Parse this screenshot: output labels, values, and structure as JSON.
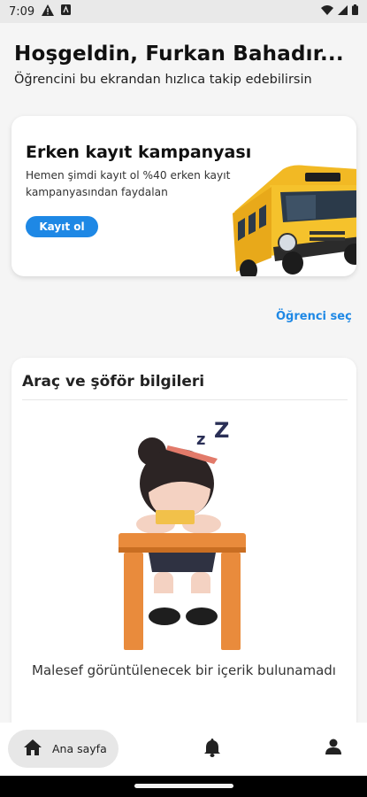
{
  "status_bar": {
    "time": "7:09",
    "icons": [
      "warning-icon",
      "notification-a-icon",
      "wifi-icon",
      "signal-icon",
      "battery-icon"
    ]
  },
  "header": {
    "title": "Hoşgeldin, Furkan Bahadır...",
    "subtitle": "Öğrencini bu ekrandan hızlıca takip edebilirsin"
  },
  "campaign": {
    "title": "Erken kayıt kampanyası",
    "description": "Hemen şimdi kayıt ol %40 erken kayıt kampanyasından faydalan",
    "button_label": "Kayıt ol",
    "image_icon": "school-bus-illustration"
  },
  "select_student_label": "Öğrenci seç",
  "vehicle": {
    "title": "Araç ve şöför bilgileri",
    "empty_illustration": "sleeping-student-illustration",
    "empty_message": "Malesef görüntülenecek bir içerik bulunamadı"
  },
  "bottom_nav": {
    "home_label": "Ana sayfa",
    "items": [
      "home-icon",
      "bell-icon",
      "person-icon"
    ]
  },
  "colors": {
    "accent": "#1e88e5",
    "background": "#f5f5f5"
  }
}
